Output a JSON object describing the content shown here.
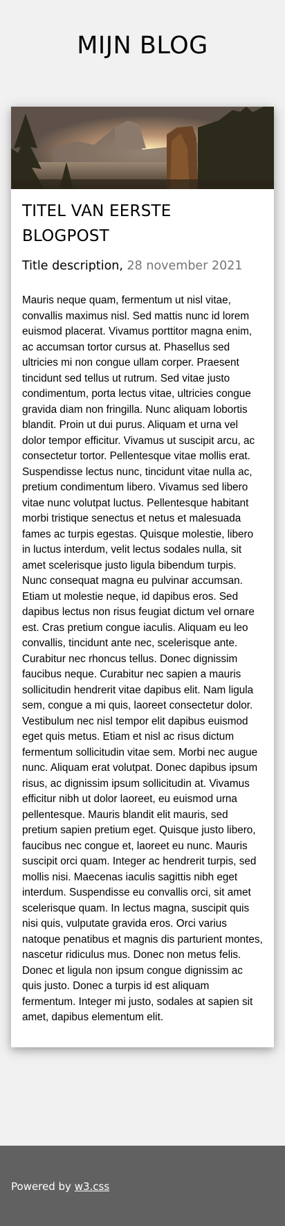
{
  "header": {
    "title": "MIJN BLOG"
  },
  "post": {
    "image_alt": "Mountains sunset",
    "title": "TITEL VAN EERSTE BLOGPOST",
    "description": "Title description,",
    "date": "28 november 2021",
    "body": "Mauris neque quam, fermentum ut nisl vitae, convallis maximus nisl. Sed mattis nunc id lorem euismod placerat. Vivamus porttitor magna enim, ac accumsan tortor cursus at. Phasellus sed ultricies mi non congue ullam corper. Praesent tincidunt sed tellus ut rutrum. Sed vitae justo condimentum, porta lectus vitae, ultricies congue gravida diam non fringilla. Nunc aliquam lobortis blandit. Proin ut dui purus. Aliquam et urna vel dolor tempor efficitur. Vivamus ut suscipit arcu, ac consectetur tortor. Pellentesque vitae mollis erat. Suspendisse lectus nunc, tincidunt vitae nulla ac, pretium condimentum libero. Vivamus sed libero vitae nunc volutpat luctus. Pellentesque habitant morbi tristique senectus et netus et malesuada fames ac turpis egestas. Quisque molestie, libero in luctus interdum, velit lectus sodales nulla, sit amet scelerisque justo ligula bibendum turpis. Nunc consequat magna eu pulvinar accumsan. Etiam ut molestie neque, id dapibus eros. Sed dapibus lectus non risus feugiat dictum vel ornare est. Cras pretium congue iaculis. Aliquam eu leo convallis, tincidunt ante nec, scelerisque ante. Curabitur nec rhoncus tellus. Donec dignissim faucibus neque. Curabitur nec sapien a mauris sollicitudin hendrerit vitae dapibus elit. Nam ligula sem, congue a mi quis, laoreet consectetur dolor. Vestibulum nec nisl tempor elit dapibus euismod eget quis metus. Etiam et nisl ac risus dictum fermentum sollicitudin vitae sem. Morbi nec augue nunc. Aliquam erat volutpat. Donec dapibus ipsum risus, ac dignissim ipsum sollicitudin at. Vivamus efficitur nibh ut dolor laoreet, eu euismod urna pellentesque. Mauris blandit elit mauris, sed pretium sapien pretium eget. Quisque justo libero, faucibus nec congue et, laoreet eu nunc. Mauris suscipit orci quam. Integer ac hendrerit turpis, sed mollis nisi. Maecenas iaculis sagittis nibh eget interdum. Suspendisse eu convallis orci, sit amet scelerisque quam. In lectus magna, suscipit quis nisi quis, vulputate gravida eros. Orci varius natoque penatibus et magnis dis parturient montes, nascetur ridiculus mus. Donec non metus felis. Donec et ligula non ipsum congue dignissim ac quis justo. Donec a turpis id est aliquam fermentum. Integer mi justo, sodales at sapien sit amet, dapibus elementum elit."
  },
  "footer": {
    "prefix": "Powered by ",
    "link_label": "w3.css"
  },
  "colors": {
    "page_bg": "#f1f1f1",
    "card_bg": "#ffffff",
    "date_gray": "#757575",
    "footer_bg": "#616161"
  }
}
